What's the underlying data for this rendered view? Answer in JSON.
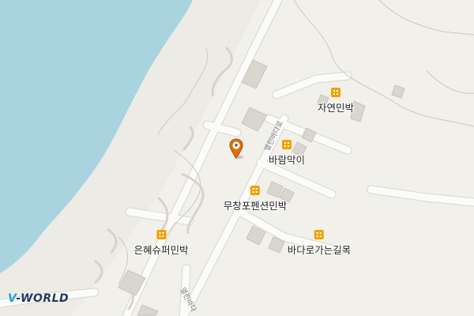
{
  "map": {
    "colors": {
      "water": "#aad3e0",
      "land": "#f1f0eb",
      "road": "#fbfbf9",
      "road_edge": "#d7d6d0",
      "building": "#d8d6cf",
      "building_edge": "#c6c4bc",
      "poi_icon": "#f2a100",
      "marker": "#e07000"
    }
  },
  "pois": [
    {
      "id": "jayeon",
      "label": "자연민박",
      "icon": "building-icon"
    },
    {
      "id": "baram",
      "label": "바람막이",
      "icon": "building-icon"
    },
    {
      "id": "muchang",
      "label": "무창포펜션민박",
      "icon": "building-icon"
    },
    {
      "id": "eunhye",
      "label": "은혜슈퍼민박",
      "icon": "building-icon"
    },
    {
      "id": "badaro",
      "label": "바다로가는길목",
      "icon": "building-icon"
    }
  ],
  "roads": [
    {
      "id": "road-upper",
      "label": "열린바다로"
    },
    {
      "id": "road-lower",
      "label": "열린바다"
    }
  ],
  "marker": {
    "icon": "location-pin-icon"
  },
  "brand": {
    "part1": "V",
    "part2": "-WORLD"
  }
}
